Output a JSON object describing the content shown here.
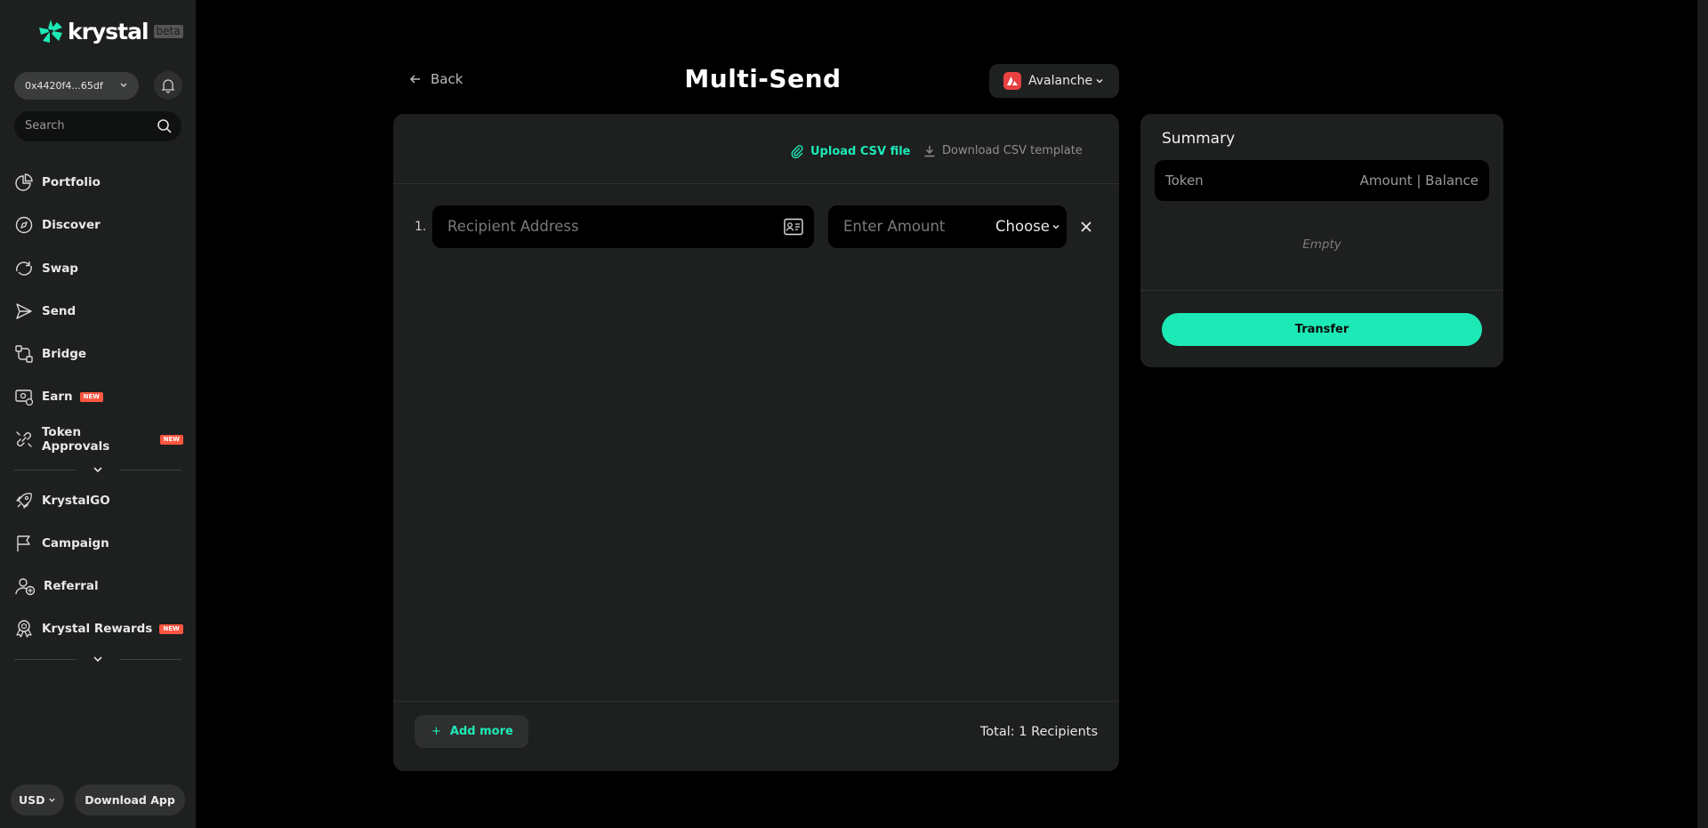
{
  "brand": {
    "name": "krystal",
    "tag": "beta"
  },
  "wallet": {
    "address": "0x4420f4...65df"
  },
  "search": {
    "placeholder": "Search"
  },
  "sidebar": {
    "items": [
      {
        "label": "Portfolio",
        "icon": "portfolio-icon"
      },
      {
        "label": "Discover",
        "icon": "discover-icon"
      },
      {
        "label": "Swap",
        "icon": "swap-icon"
      },
      {
        "label": "Send",
        "icon": "send-icon"
      },
      {
        "label": "Bridge",
        "icon": "bridge-icon"
      },
      {
        "label": "Earn",
        "icon": "earn-icon",
        "badge": "NEW"
      },
      {
        "label": "Token Approvals",
        "icon": "token-approvals-icon",
        "badge": "NEW"
      },
      {
        "label": "KrystalGO",
        "icon": "rocket-icon"
      },
      {
        "label": "Campaign",
        "icon": "flag-icon"
      },
      {
        "label": "Referral",
        "icon": "referral-icon"
      },
      {
        "label": "Krystal Rewards",
        "icon": "rewards-icon",
        "badge": "NEW"
      }
    ]
  },
  "footer": {
    "currency": "USD",
    "download_label": "Download App"
  },
  "header": {
    "back_label": "Back",
    "title": "Multi-Send",
    "network": "Avalanche"
  },
  "main": {
    "upload_label": "Upload CSV file",
    "download_template_label": "Download CSV template",
    "rows": [
      {
        "index": "1.",
        "address_placeholder": "Recipient Address",
        "amount_placeholder": "Enter Amount",
        "token_label": "Choose"
      }
    ],
    "add_more_label": "Add more",
    "add_more_symbol": "+",
    "total_label": "Total: 1 Recipients"
  },
  "summary": {
    "title": "Summary",
    "col_token": "Token",
    "col_amount": "Amount | Balance",
    "empty_label": "Empty",
    "transfer_label": "Transfer"
  },
  "colors": {
    "accent": "#1de9b6",
    "badge": "#ff5640",
    "avalanche": "#e84142",
    "panel": "#1e1f1f"
  }
}
